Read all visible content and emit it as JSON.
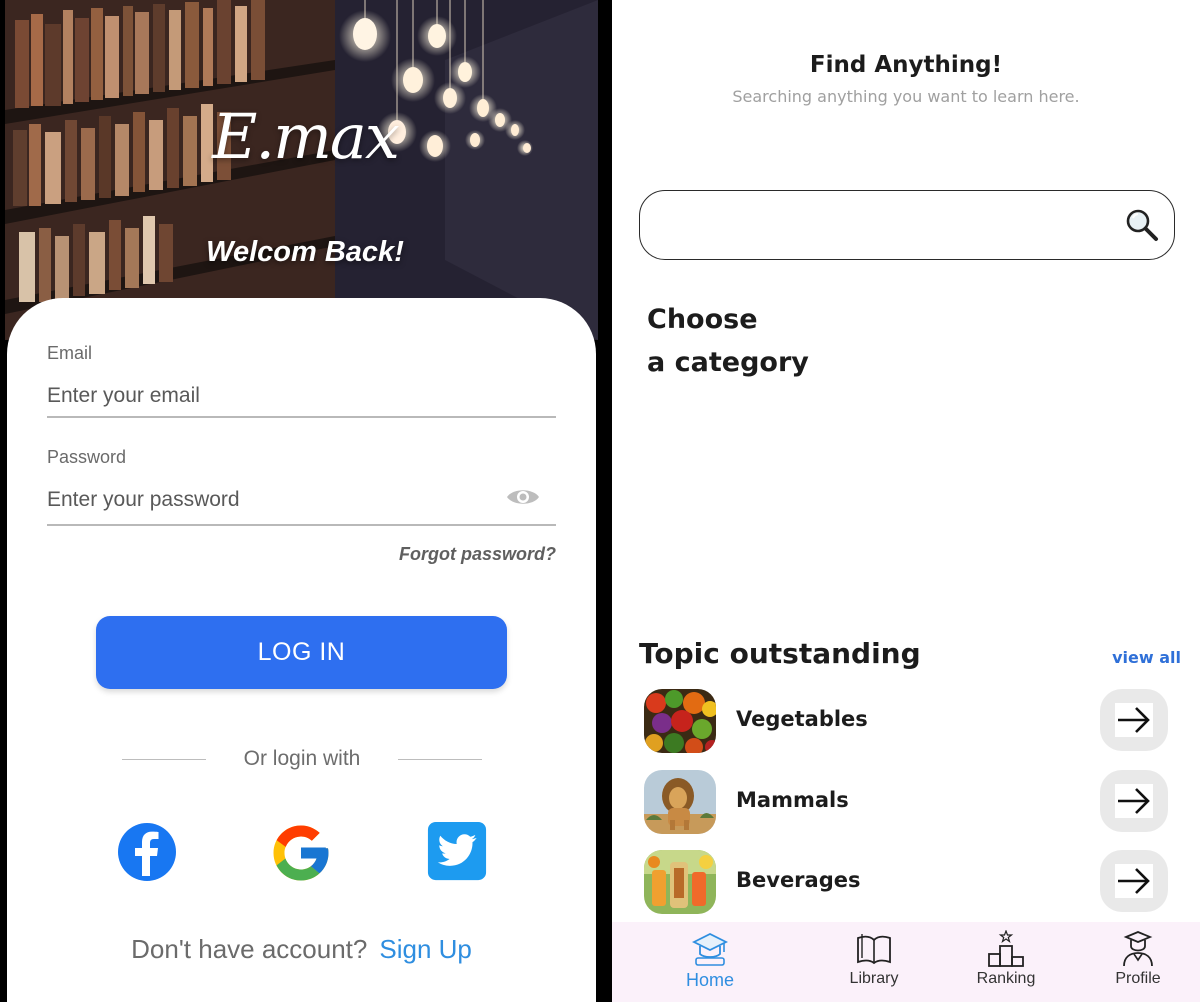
{
  "login_screen": {
    "brand": "E.max",
    "welcome": "Welcom Back!",
    "email": {
      "label": "Email",
      "placeholder": "Enter your email"
    },
    "password": {
      "label": "Password",
      "placeholder": "Enter your password",
      "toggle_icon": "eye-icon"
    },
    "forgot_password": "Forgot password?",
    "login_button": "LOG IN",
    "or_login_with": "Or login with",
    "social": [
      "facebook-icon",
      "google-icon",
      "twitter-icon"
    ],
    "signup_prompt": "Don't have account?",
    "signup_link": "Sign Up",
    "colors": {
      "primary": "#2e6ff0",
      "link": "#2f8ee0"
    }
  },
  "search_screen": {
    "title": "Find Anything!",
    "subtitle": "Searching anything you want to learn here.",
    "search_icon": "search-icon",
    "category_title_line1": "Choose",
    "category_title_line2": "a category",
    "topics_title": "Topic outstanding",
    "view_all": "view all",
    "topics": [
      {
        "name": "Vegetables",
        "icon": "vegetables-thumbnail"
      },
      {
        "name": "Mammals",
        "icon": "lion-thumbnail"
      },
      {
        "name": "Beverages",
        "icon": "beverages-thumbnail"
      }
    ],
    "nav": [
      {
        "label": "Home",
        "icon": "graduation-cap-icon",
        "active": true
      },
      {
        "label": "Library",
        "icon": "book-icon",
        "active": false
      },
      {
        "label": "Ranking",
        "icon": "podium-icon",
        "active": false
      },
      {
        "label": "Profile",
        "icon": "graduate-avatar-icon",
        "active": false
      }
    ],
    "colors": {
      "accent": "#2f70d8",
      "nav_bg": "#fbf1fa"
    }
  }
}
